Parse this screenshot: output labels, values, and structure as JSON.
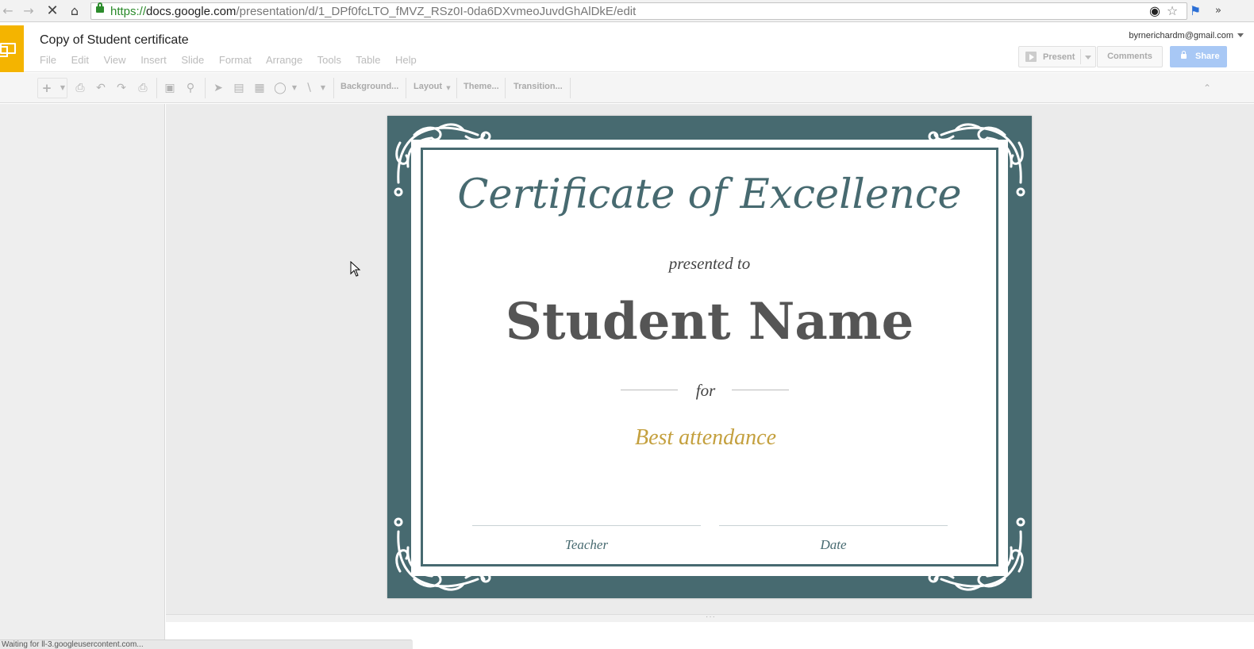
{
  "browser": {
    "url_scheme": "https://",
    "url_host": "docs.google.com",
    "url_path": "/presentation/d/1_DPf0fcLTO_fMVZ_RSz0I-0da6DXvmeoJuvdGhAlDkE/edit",
    "back_icon": "back-arrow",
    "forward_icon": "forward-arrow",
    "stop_icon": "stop-x",
    "home_icon": "home"
  },
  "app": {
    "doc_title": "Copy of Student certificate",
    "account_email": "byrnerichardm@gmail.com",
    "menu": [
      "File",
      "Edit",
      "View",
      "Insert",
      "Slide",
      "Format",
      "Arrange",
      "Tools",
      "Table",
      "Help"
    ],
    "present_label": "Present",
    "comments_label": "Comments",
    "share_label": "Share",
    "brand_color": "#f4b400",
    "share_color": "#a8c8f5"
  },
  "toolbar": {
    "background_label": "Background...",
    "layout_label": "Layout",
    "theme_label": "Theme...",
    "transition_label": "Transition..."
  },
  "slide": {
    "title": "Certificate of Excellence",
    "presented_to": "presented to",
    "student_name": "Student Name",
    "for": "for",
    "award": "Best attendance",
    "signature_left": "Teacher",
    "signature_right": "Date",
    "frame_color": "#476a70",
    "award_color": "#c4a03e"
  },
  "status": {
    "text": "Waiting for ll-3.googleusercontent.com..."
  }
}
